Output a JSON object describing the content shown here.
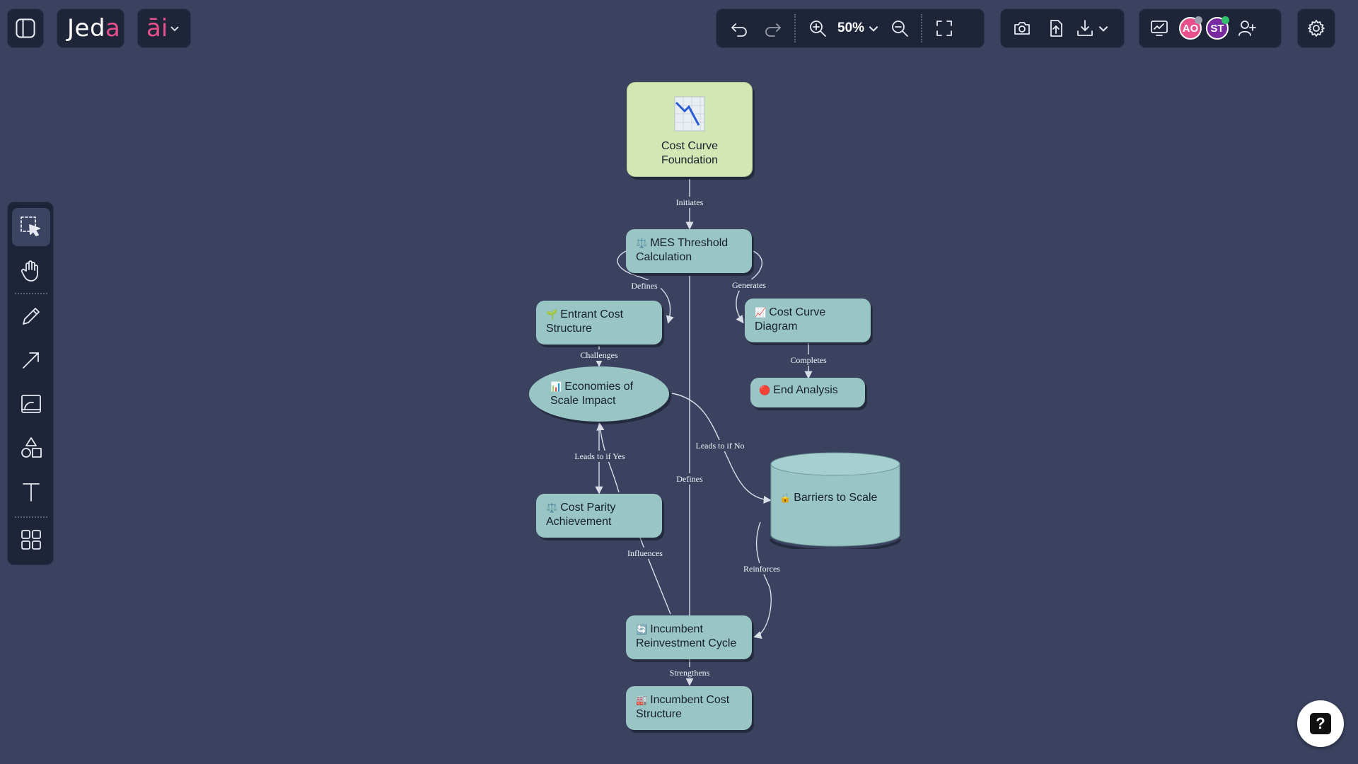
{
  "app": {
    "logo_main": "Jed",
    "logo_accent": "a",
    "ai_label": "āi"
  },
  "toolbar": {
    "zoom_level": "50%"
  },
  "collaborators": [
    {
      "initials": "AO",
      "color": "#e8508c",
      "status_color": "#9aa0ad"
    },
    {
      "initials": "ST",
      "color": "#7a2aa0",
      "status_color": "#2fc26b"
    }
  ],
  "diagram": {
    "nodes": {
      "cost_curve_foundation": {
        "icon": "📉",
        "label": "Cost Curve Foundation"
      },
      "mes_threshold": {
        "icon": "⚖️",
        "label": "MES Threshold Calculation"
      },
      "entrant_cost": {
        "icon": "🌱",
        "label": "Entrant Cost Structure"
      },
      "cost_curve_diagram": {
        "icon": "📈",
        "label": "Cost Curve Diagram"
      },
      "end_analysis": {
        "icon": "🔴",
        "label": "End Analysis"
      },
      "economies_scale": {
        "icon": "📊",
        "label": "Economies of Scale Impact"
      },
      "barriers_scale": {
        "icon": "🔒",
        "label": "Barriers to Scale"
      },
      "cost_parity": {
        "icon": "⚖️",
        "label": "Cost Parity Achievement"
      },
      "incumbent_reinvestment": {
        "icon": "🔄",
        "label": "Incumbent Reinvestment Cycle"
      },
      "incumbent_cost": {
        "icon": "🏭",
        "label": "Incumbent Cost Structure"
      }
    },
    "edges": {
      "initiates": "Initiates",
      "defines_left": "Defines",
      "generates": "Generates",
      "challenges": "Challenges",
      "completes": "Completes",
      "leads_no": "Leads to if No",
      "defines_center": "Defines",
      "leads_yes": "Leads to if Yes",
      "influences": "Influences",
      "reinforces": "Reinforces",
      "strengthens": "Strengthens"
    }
  },
  "help": {
    "label": "?"
  }
}
